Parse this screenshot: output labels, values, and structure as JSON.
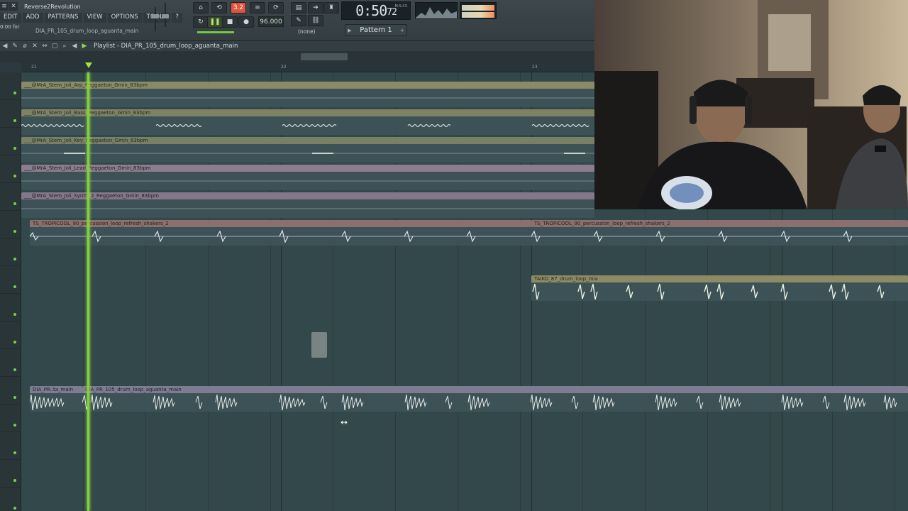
{
  "window": {
    "close": "✕",
    "title": "Reverse2Revolution"
  },
  "menu": [
    "EDIT",
    "ADD",
    "PATTERNS",
    "VIEW",
    "OPTIONS",
    "TOOLS",
    "?"
  ],
  "hint_text": "0:00 for",
  "current_pattern_file": "DIA_PR_105_drum_loop_aguanta_main",
  "transport": {
    "rec_label": "3.2",
    "tempo": "96.000",
    "pattern_mode": "(none)",
    "time": "0:50",
    "time_small": "72",
    "time_unit": "M:S:CS"
  },
  "pattern_selector": {
    "label": "Pattern 1"
  },
  "playlist": {
    "title": "Playlist - DIA_PR_105_drum_loop_aguanta_main",
    "bars": [
      "21",
      "22",
      "23"
    ]
  },
  "clips": [
    {
      "name": "___@MrA_Stem_Joli_Arp_Reggaeton_Gmin_83bpm"
    },
    {
      "name": "___@MrA_Stem_Joli_Bass_Reggaeton_Gmin_83bpm"
    },
    {
      "name": "___@MrA_Stem_Joli_Key_Reggaeton_Gmin_83bpm"
    },
    {
      "name": "___@MrA_Stem_Joli_Lead_Reggaeton_Gmin_83bpm"
    },
    {
      "name": "___@MrA_Stem_Joli_Synth_2_Reggaeton_Gmin_83bpm"
    },
    {
      "name": "TS_TROPICOOL_90_percussion_loop_refresh_shakers_2"
    },
    {
      "name": "TS_TROPICOOL_90_percussion_loop_refresh_shakers_2"
    },
    {
      "name": "TAIKO_87_drum_loop_mia"
    },
    {
      "name": "DIA_PR..ta_main"
    },
    {
      "name": "DIA_PR_105_drum_loop_aguanta_main"
    }
  ],
  "colors": {
    "accent_record": "#e2533d",
    "playhead": "#7fd42e"
  }
}
